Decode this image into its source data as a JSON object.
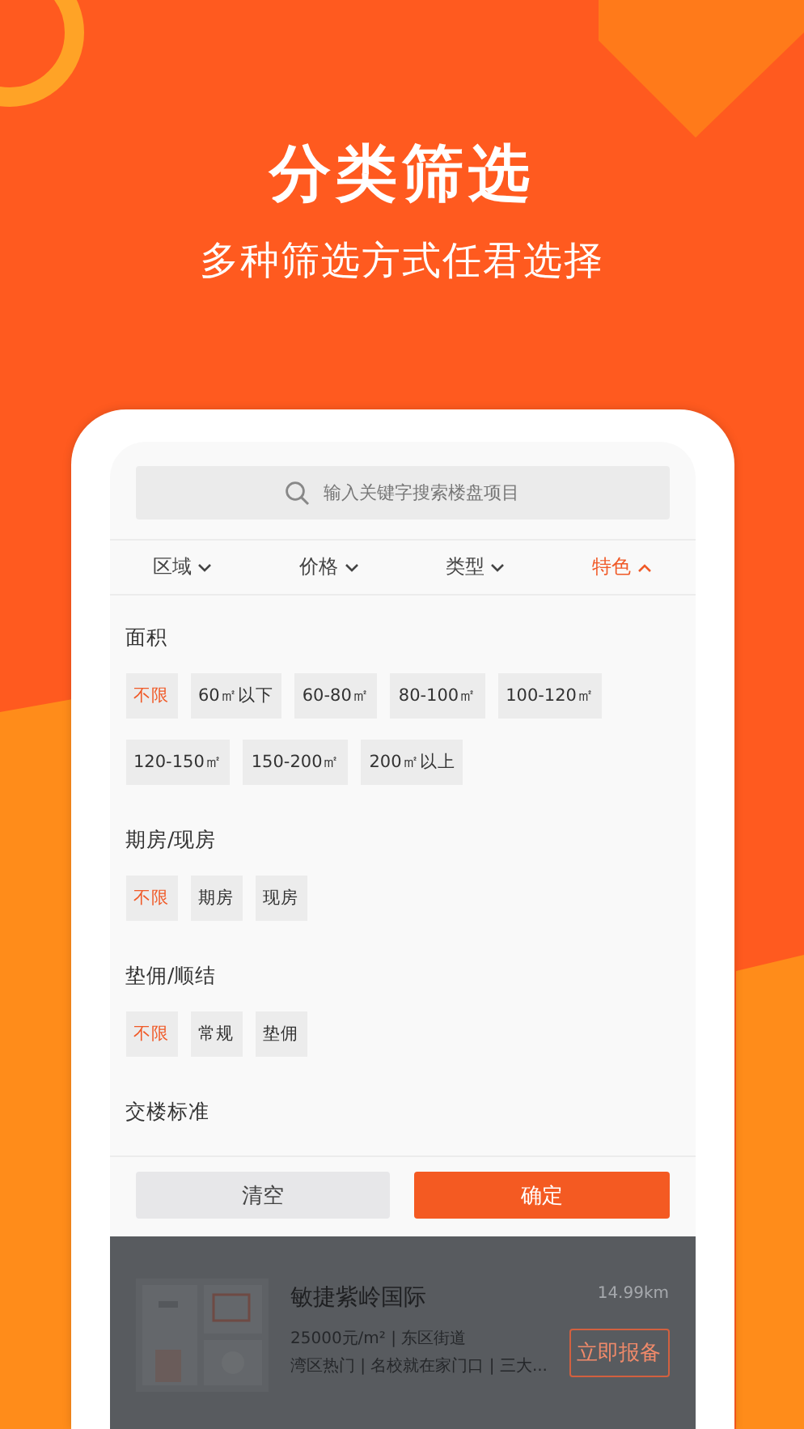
{
  "headline": "分类筛选",
  "subheadline": "多种筛选方式任君选择",
  "search": {
    "placeholder": "输入关键字搜索楼盘项目"
  },
  "tabs": [
    {
      "label": "区域",
      "selected": false
    },
    {
      "label": "价格",
      "selected": false
    },
    {
      "label": "类型",
      "selected": false
    },
    {
      "label": "特色",
      "selected": true
    }
  ],
  "filter_groups": [
    {
      "title": "面积",
      "options": [
        {
          "label": "不限",
          "selected": true
        },
        {
          "label": "60㎡以下",
          "selected": false
        },
        {
          "label": "60-80㎡",
          "selected": false
        },
        {
          "label": "80-100㎡",
          "selected": false
        },
        {
          "label": "100-120㎡",
          "selected": false
        },
        {
          "label": "120-150㎡",
          "selected": false
        },
        {
          "label": "150-200㎡",
          "selected": false
        },
        {
          "label": "200㎡以上",
          "selected": false
        }
      ]
    },
    {
      "title": "期房/现房",
      "options": [
        {
          "label": "不限",
          "selected": true
        },
        {
          "label": "期房",
          "selected": false
        },
        {
          "label": "现房",
          "selected": false
        }
      ]
    },
    {
      "title": "垫佣/顺结",
      "options": [
        {
          "label": "不限",
          "selected": true
        },
        {
          "label": "常规",
          "selected": false
        },
        {
          "label": "垫佣",
          "selected": false
        }
      ]
    },
    {
      "title": "交楼标准"
    }
  ],
  "buttons": [
    {
      "label": "清空",
      "kind": "secondary"
    },
    {
      "label": "确定",
      "kind": "primary"
    }
  ],
  "listing": {
    "kind": "picture",
    "name": "敏捷紫岭国际",
    "distance": "14.99km",
    "price_area": "25000元/m² | 东区街道",
    "tags": "湾区热门 | 名校就在家门口 | 三大...",
    "action": "立即报备"
  }
}
